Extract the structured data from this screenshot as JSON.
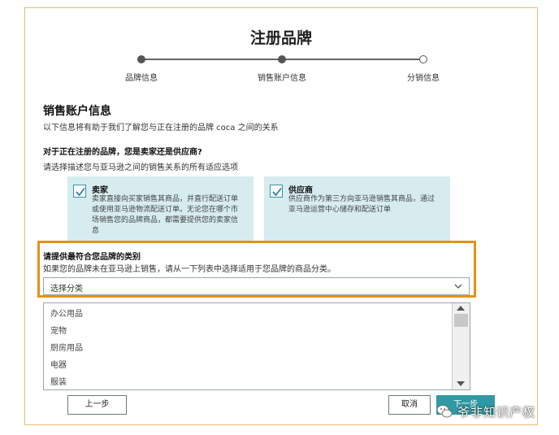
{
  "page": {
    "title": "注册品牌"
  },
  "stepper": {
    "steps": [
      {
        "label": "品牌信息",
        "state": "done"
      },
      {
        "label": "销售账户信息",
        "state": "current"
      },
      {
        "label": "分销信息",
        "state": "pending"
      }
    ]
  },
  "section": {
    "title": "销售账户信息",
    "subtitle": "以下信息将有助于我们了解您与正在注册的品牌 coca 之间的关系"
  },
  "relationship": {
    "question": "对于正在注册的品牌，您是卖家还是供应商?",
    "hint": "请选择描述您与亚马逊之间的销售关系的所有适应选项",
    "options": [
      {
        "title": "卖家",
        "checked": true,
        "desc_lines": [
          "卖家直接向买家销售其商品，并直行配送订单",
          "或使用亚马逊物流配送订单。无论您在哪个市",
          "场销售您的品牌商品，都需要提供您的卖家信",
          "息"
        ]
      },
      {
        "title": "供应商",
        "checked": true,
        "desc_lines": [
          "供应商作为第三方向亚马逊销售其商品，通过",
          "亚马逊运营中心储存和配送订单"
        ]
      }
    ]
  },
  "category": {
    "label": "请提供最符合您品牌的类别",
    "hint": "如果您的品牌未在亚马逊上销售，请从一下列表中选择适用于您品牌的商品分类。",
    "select_value": "选择分类",
    "options": [
      "办公用品",
      "宠物",
      "厨房用品",
      "电器",
      "服装"
    ]
  },
  "buttons": {
    "back": "上一步",
    "cancel": "取消",
    "next": "下一步"
  },
  "watermark": {
    "text": "爷非知识产权"
  },
  "colors": {
    "frame_border": "#f0b873",
    "highlight": "#e49217",
    "option_bg": "#d6ecef",
    "primary": "#2f9aa3"
  }
}
